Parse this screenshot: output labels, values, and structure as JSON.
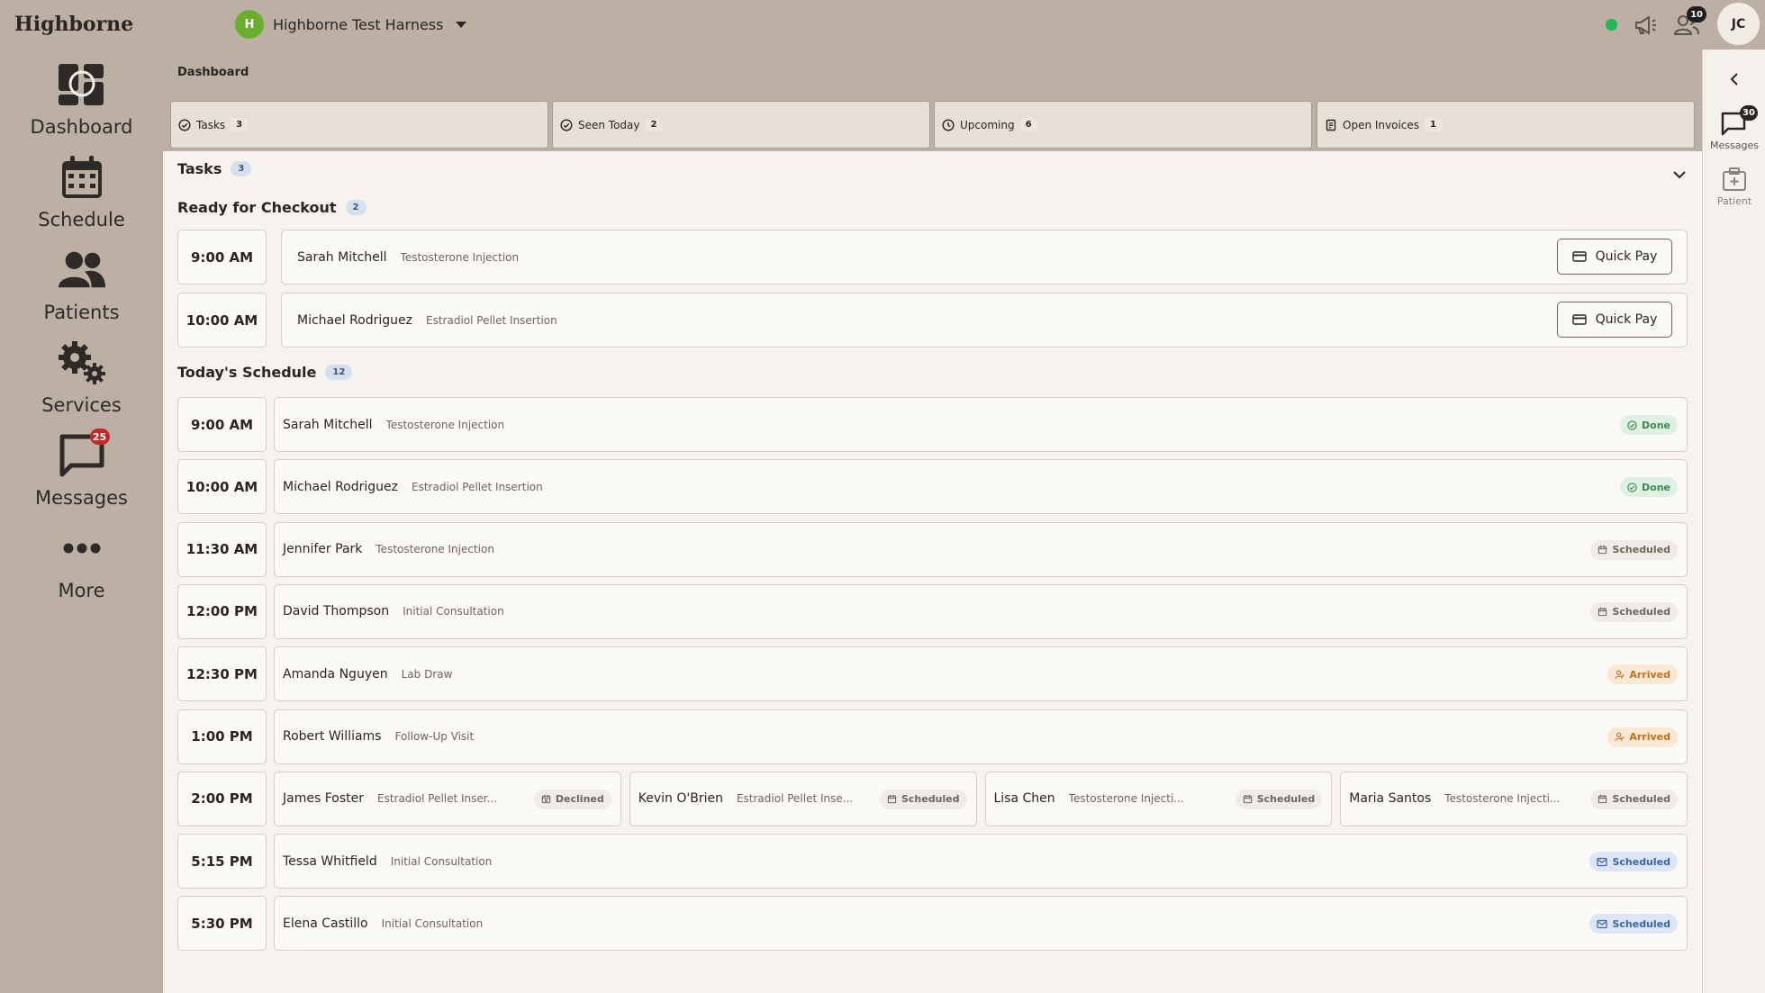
{
  "app": {
    "brand": "Highborne"
  },
  "org": {
    "initial": "H",
    "name": "Highborne Test Harness",
    "avatar_color": "#6aae2e"
  },
  "header": {
    "notifications_badge": "10",
    "user_initials": "JC",
    "online_status_color": "#1db954"
  },
  "nav": {
    "items": [
      {
        "label": "Dashboard",
        "icon": "dashboard-icon"
      },
      {
        "label": "Schedule",
        "icon": "calendar-icon"
      },
      {
        "label": "Patients",
        "icon": "people-icon"
      },
      {
        "label": "Services",
        "icon": "gears-icon"
      },
      {
        "label": "Messages",
        "icon": "chat-icon",
        "badge": "25"
      },
      {
        "label": "More",
        "icon": "more-dots-icon"
      }
    ]
  },
  "rail": {
    "messages_label": "Messages",
    "messages_badge": "30",
    "patient_label": "Patient"
  },
  "breadcrumb": "Dashboard",
  "tabs": [
    {
      "label": "Tasks",
      "count": "3",
      "icon": "check-circle-icon"
    },
    {
      "label": "Seen Today",
      "count": "2",
      "icon": "check-circle-icon"
    },
    {
      "label": "Upcoming",
      "count": "6",
      "icon": "clock-icon"
    },
    {
      "label": "Open Invoices",
      "count": "1",
      "icon": "invoice-icon"
    }
  ],
  "tasks": {
    "title": "Tasks",
    "count": "3"
  },
  "checkout": {
    "title": "Ready for Checkout",
    "count": "2",
    "action_label": "Quick Pay",
    "rows": [
      {
        "time": "9:00 AM",
        "name": "Sarah Mitchell",
        "service": "Testosterone Injection"
      },
      {
        "time": "10:00 AM",
        "name": "Michael Rodriguez",
        "service": "Estradiol Pellet Insertion"
      }
    ]
  },
  "schedule": {
    "title": "Today's Schedule",
    "count": "12",
    "rows": [
      {
        "time": "9:00 AM",
        "appts": [
          {
            "name": "Sarah Mitchell",
            "service": "Testosterone Injection",
            "status": "Done",
            "kind": "done"
          }
        ]
      },
      {
        "time": "10:00 AM",
        "appts": [
          {
            "name": "Michael Rodriguez",
            "service": "Estradiol Pellet Insertion",
            "status": "Done",
            "kind": "done"
          }
        ]
      },
      {
        "time": "11:30 AM",
        "appts": [
          {
            "name": "Jennifer Park",
            "service": "Testosterone Injection",
            "status": "Scheduled",
            "kind": "scheduled"
          }
        ]
      },
      {
        "time": "12:00 PM",
        "appts": [
          {
            "name": "David Thompson",
            "service": "Initial Consultation",
            "status": "Scheduled",
            "kind": "scheduled"
          }
        ]
      },
      {
        "time": "12:30 PM",
        "appts": [
          {
            "name": "Amanda Nguyen",
            "service": "Lab Draw",
            "status": "Arrived",
            "kind": "arrived"
          }
        ]
      },
      {
        "time": "1:00 PM",
        "appts": [
          {
            "name": "Robert Williams",
            "service": "Follow-Up Visit",
            "status": "Arrived",
            "kind": "arrived"
          }
        ]
      },
      {
        "time": "2:00 PM",
        "appts": [
          {
            "name": "James Foster",
            "service": "Estradiol Pellet Inser...",
            "status": "Declined",
            "kind": "declined"
          },
          {
            "name": "Kevin O'Brien",
            "service": "Estradiol Pellet Inse...",
            "status": "Scheduled",
            "kind": "scheduled"
          },
          {
            "name": "Lisa Chen",
            "service": "Testosterone Injecti...",
            "status": "Scheduled",
            "kind": "scheduled"
          },
          {
            "name": "Maria Santos",
            "service": "Testosterone Injecti...",
            "status": "Scheduled",
            "kind": "scheduled"
          }
        ]
      },
      {
        "time": "5:15 PM",
        "appts": [
          {
            "name": "Tessa Whitfield",
            "service": "Initial Consultation",
            "status": "Scheduled",
            "kind": "confirmed"
          }
        ]
      },
      {
        "time": "5:30 PM",
        "appts": [
          {
            "name": "Elena Castillo",
            "service": "Initial Consultation",
            "status": "Scheduled",
            "kind": "confirmed"
          }
        ]
      }
    ]
  }
}
